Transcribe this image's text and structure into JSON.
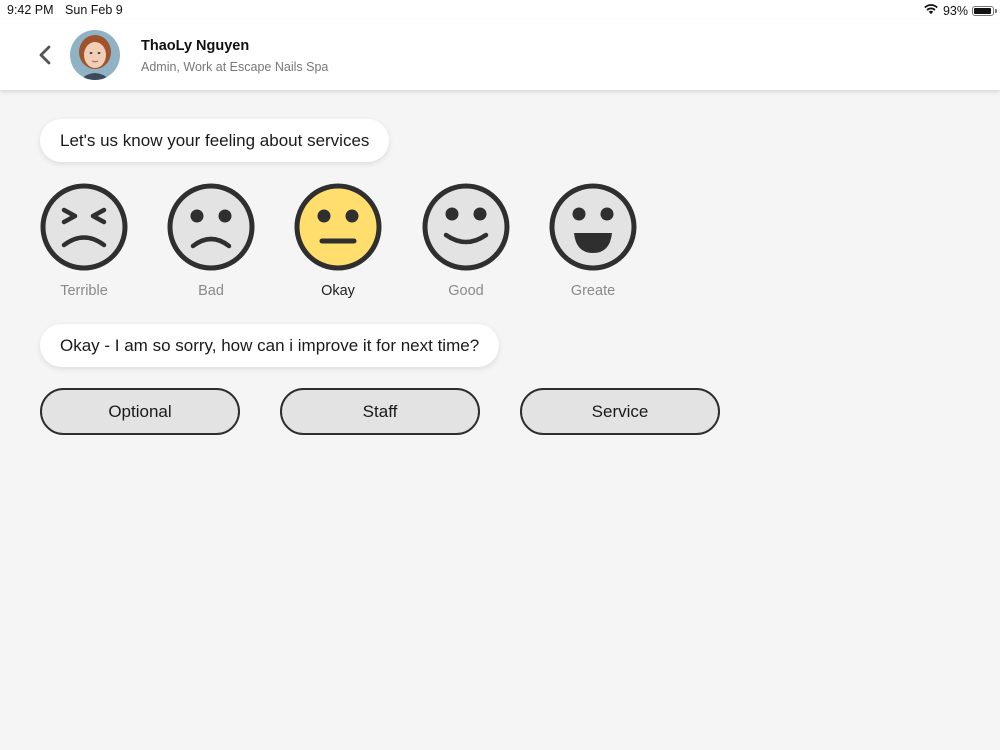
{
  "status_bar": {
    "time": "9:42 PM",
    "date": "Sun Feb 9",
    "battery": "93%",
    "battery_level": 0.93,
    "wifi_icon": "wifi-icon",
    "battery_icon": "battery-icon"
  },
  "header": {
    "back_icon": "chevron-left-icon",
    "user_name": "ThaoLy Nguyen",
    "user_role": "Admin, Work at Escape Nails Spa"
  },
  "prompt": {
    "question": "Let's us know your feeling about services",
    "follow_up": "Okay - I am so sorry, how can i improve it for next time?"
  },
  "ratings": [
    {
      "label": "Terrible",
      "icon": "terrible-face-icon",
      "selected": false
    },
    {
      "label": "Bad",
      "icon": "bad-face-icon",
      "selected": false
    },
    {
      "label": "Okay",
      "icon": "okay-face-icon",
      "selected": true
    },
    {
      "label": "Good",
      "icon": "good-face-icon",
      "selected": false
    },
    {
      "label": "Greate",
      "icon": "great-face-icon",
      "selected": false
    }
  ],
  "options": [
    {
      "label": "Optional"
    },
    {
      "label": "Staff"
    },
    {
      "label": "Service"
    }
  ],
  "colors": {
    "face_default": "#e3e3e3",
    "face_selected": "#ffde6e",
    "face_outline": "#2f2f2f",
    "background": "#f5f5f5"
  }
}
